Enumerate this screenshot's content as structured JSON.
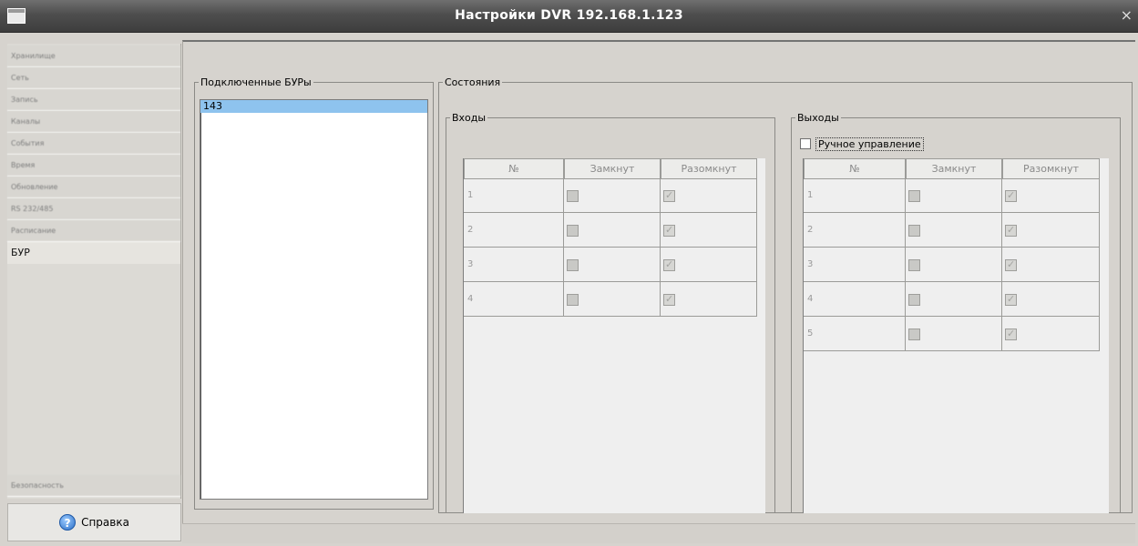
{
  "window": {
    "title": "Настройки DVR 192.168.1.123",
    "close_glyph": "×"
  },
  "sidebar": {
    "items": [
      {
        "label": "Хранилище"
      },
      {
        "label": "Сеть"
      },
      {
        "label": "Запись"
      },
      {
        "label": "Каналы"
      },
      {
        "label": "События"
      },
      {
        "label": "Время"
      },
      {
        "label": "Обновление"
      },
      {
        "label": "RS 232/485"
      },
      {
        "label": "Расписание"
      },
      {
        "label": "БУР",
        "active": true
      }
    ],
    "bottom_item": "Безопасность"
  },
  "help_button": {
    "label": "Справка",
    "icon": "help-icon"
  },
  "connected": {
    "legend": "Подключенные БУРы",
    "items": [
      "143"
    ],
    "selected": "143"
  },
  "states": {
    "legend": "Состояния",
    "inputs": {
      "legend": "Входы",
      "columns": [
        "№",
        "Замкнут",
        "Разомкнут"
      ],
      "rows": [
        {
          "n": "1",
          "closed": false,
          "open": true
        },
        {
          "n": "2",
          "closed": false,
          "open": true
        },
        {
          "n": "3",
          "closed": false,
          "open": true
        },
        {
          "n": "4",
          "closed": false,
          "open": true
        }
      ]
    },
    "outputs": {
      "legend": "Выходы",
      "manual_label": "Ручное управление",
      "manual_checked": false,
      "columns": [
        "№",
        "Замкнут",
        "Разомкнут"
      ],
      "rows": [
        {
          "n": "1",
          "closed": false,
          "open": true
        },
        {
          "n": "2",
          "closed": false,
          "open": true
        },
        {
          "n": "3",
          "closed": false,
          "open": true
        },
        {
          "n": "4",
          "closed": false,
          "open": true
        },
        {
          "n": "5",
          "closed": false,
          "open": true
        }
      ]
    }
  }
}
